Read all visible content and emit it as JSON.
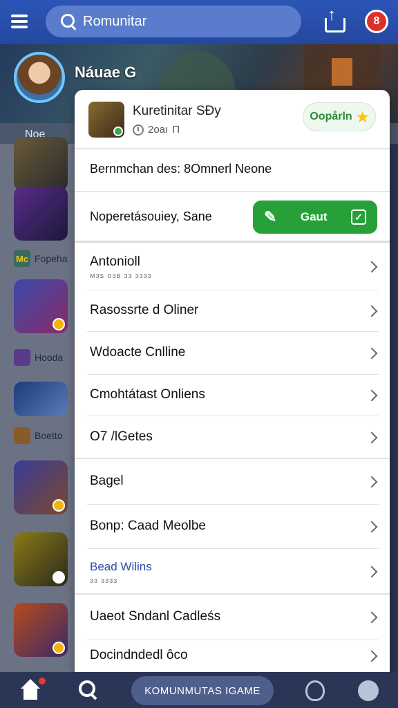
{
  "header": {
    "search_value": "Romunitar"
  },
  "banner": {
    "title": "Náuae G",
    "tab": "Noe"
  },
  "left_list": {
    "chips": [
      "Fopeha",
      "Hooda",
      "Boetto"
    ],
    "chip_prefix": "Mc"
  },
  "card": {
    "app_name": "Kuretinitar SÐy",
    "meta": "2oaı",
    "meta_suffix": "Π",
    "open_label": "Oopårln",
    "description": "Bernmchan des: 8Omnerl Neone",
    "promo_text": "Noperetásouiey, Sane",
    "get_label": "Gaut",
    "rows": [
      {
        "label": "Antonioll",
        "sub": "ᴍɜꜱ ᴏɜʙ ɜɜ ɜɜɜɜ",
        "blue": false
      },
      {
        "label": "Rasossrte d Oliner",
        "sub": "",
        "blue": false
      },
      {
        "label": "Wdoacte Cnlline",
        "sub": "",
        "blue": false
      },
      {
        "label": "Cmohtátast Onliens",
        "sub": "",
        "blue": false
      },
      {
        "label": "O7 /lGetes",
        "sub": "",
        "blue": false
      },
      {
        "label": "Bagel",
        "sub": "",
        "blue": false
      },
      {
        "label": "Bonp: Caad Meolbe",
        "sub": "",
        "blue": false
      },
      {
        "label": "Bead Wilins",
        "sub": "ɜɜ ɜɜɜɜ",
        "blue": true
      },
      {
        "label": "Uaeot Sndanl Cadleśs",
        "sub": "",
        "blue": false
      },
      {
        "label": "Docindndedl ôco",
        "sub": "",
        "blue": false
      }
    ]
  },
  "bottom_nav": {
    "community_label": "KOMUNMUTAS IGAME"
  }
}
